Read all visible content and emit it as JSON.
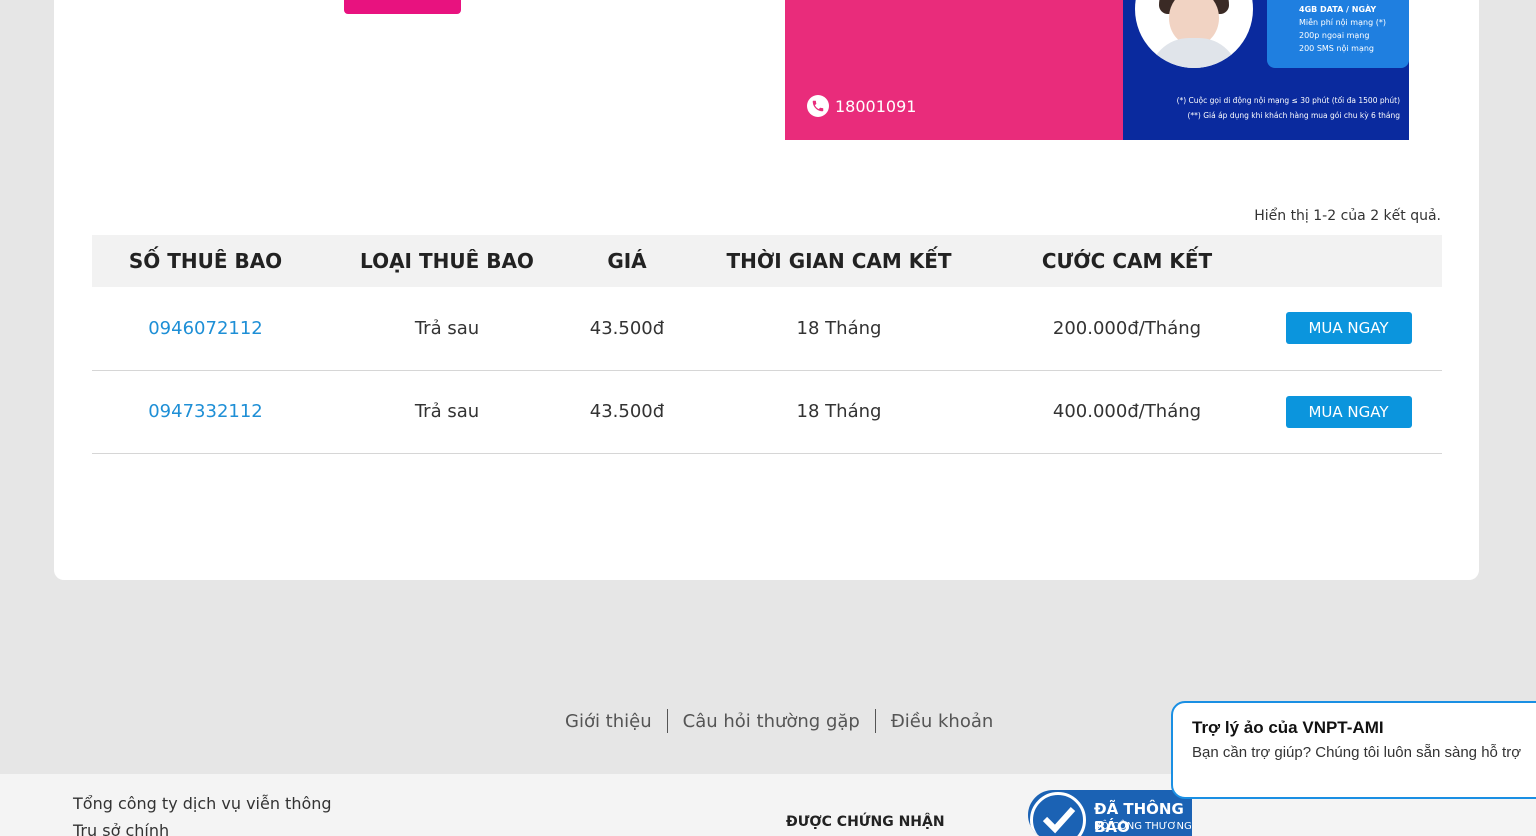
{
  "banner": {
    "hotline": "18001091",
    "plan_lines": [
      "4GB DATA / NGÀY",
      "Miễn phí nội mạng (*)",
      "200p ngoại mạng",
      "200 SMS nội mạng"
    ],
    "notes": [
      "(*) Cuộc gọi di động nội mạng ≤ 30 phút (tối đa 1500 phút)",
      "(**) Giá áp dụng khi khách hàng mua gói chu kỳ 6 tháng"
    ],
    "colors": {
      "pink": "#e92c7b",
      "navy": "#0a2a9e",
      "blue": "#1f7fe0"
    }
  },
  "results": {
    "summary": "Hiển thị 1-2 của 2 kết quả."
  },
  "table": {
    "headers": [
      "SỐ THUÊ BAO",
      "LOẠI THUÊ BAO",
      "GIÁ",
      "THỜI GIAN CAM KẾT",
      "CƯỚC CAM KẾT"
    ],
    "rows": [
      {
        "number": "0946072112",
        "type": "Trả sau",
        "price": "43.500đ",
        "term": "18 Tháng",
        "commitment": "200.000đ/Tháng",
        "action": "MUA NGAY"
      },
      {
        "number": "0947332112",
        "type": "Trả sau",
        "price": "43.500đ",
        "term": "18 Tháng",
        "commitment": "400.000đ/Tháng",
        "action": "MUA NGAY"
      }
    ]
  },
  "footer": {
    "links": [
      "Giới thiệu",
      "Câu hỏi thường gặp",
      "Điều khoản"
    ],
    "company_lines": [
      "Tổng công ty dịch vụ viễn thông",
      "Trụ sở chính"
    ],
    "certified_label": "ĐƯỢC CHỨNG NHẬN",
    "badge": {
      "line1": "ĐÃ THÔNG BÁO",
      "line2": "BỘ CÔNG THƯƠNG"
    }
  },
  "chat": {
    "title": "Trợ lý ảo của VNPT-AMI",
    "message": "Bạn cần trợ giúp? Chúng tôi luôn sẵn sàng hỗ trợ"
  },
  "accent_colors": {
    "primary_blue": "#0b95dd",
    "link_blue": "#1e8fd6",
    "brand_pink": "#e8127f"
  }
}
